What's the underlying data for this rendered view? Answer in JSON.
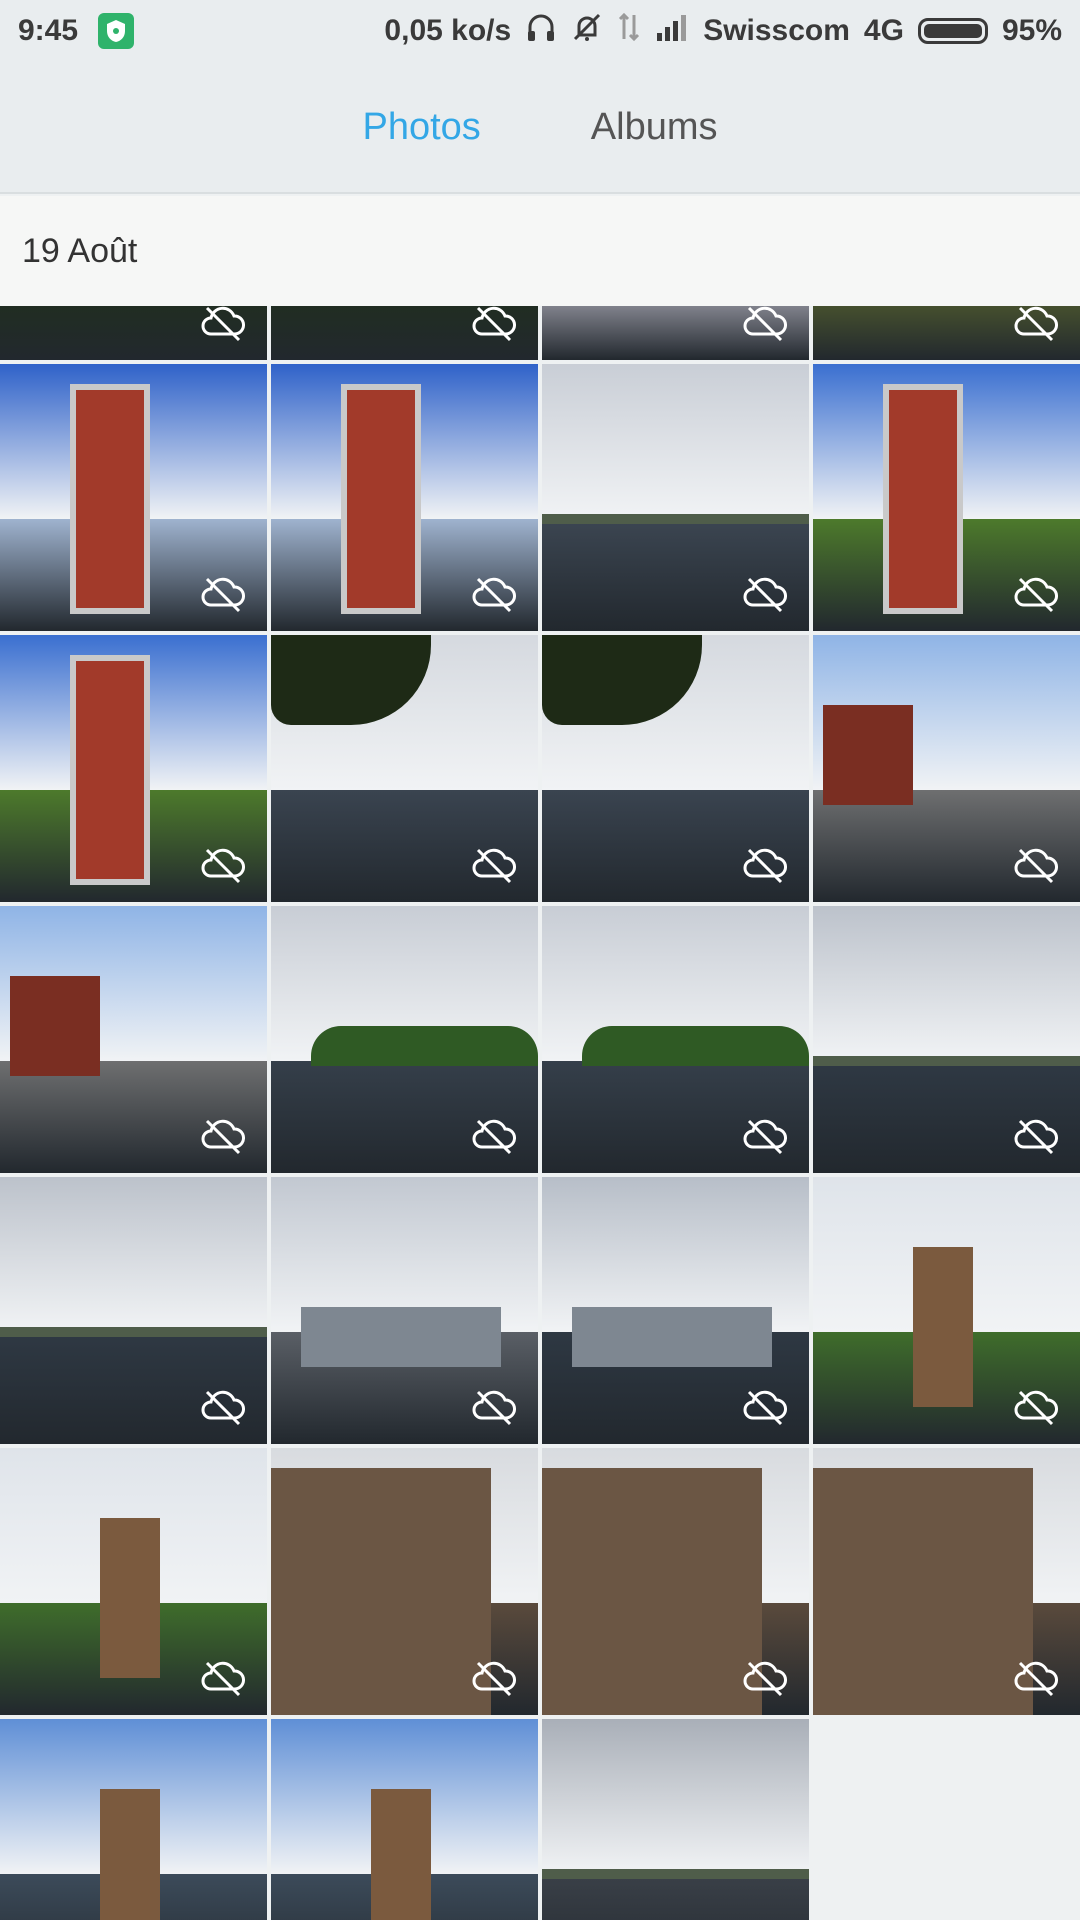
{
  "status_bar": {
    "time": "9:45",
    "network_speed": "0,05 ko/s",
    "carrier": "Swisscom",
    "network_type": "4G",
    "battery": "95%",
    "battery_level": 0.95
  },
  "tabs": [
    {
      "label": "Photos",
      "active": true
    },
    {
      "label": "Albums",
      "active": false
    }
  ],
  "section": {
    "date": "19 Août"
  },
  "photos": {
    "count": 27,
    "sync_icon": "cloud-off-icon",
    "scenes": [
      "trees",
      "trees",
      "people",
      "grass",
      "castle-red",
      "castle-red",
      "harbor-clouds",
      "castle-tree",
      "castle-tree",
      "lake-tree",
      "lake-tree",
      "church-path",
      "church-path",
      "lake-shore",
      "lake-shore",
      "lake-wide",
      "lake-wide",
      "ship-people",
      "harbor-boats",
      "museum-trees",
      "museum-trees",
      "stone-building",
      "stone-building",
      "stone-building",
      "museum-water",
      "museum-water",
      "lake-clouds"
    ]
  },
  "colors": {
    "accent": "#33a7e6",
    "tab_inactive": "#555555",
    "header_bg": "#e9edef"
  }
}
